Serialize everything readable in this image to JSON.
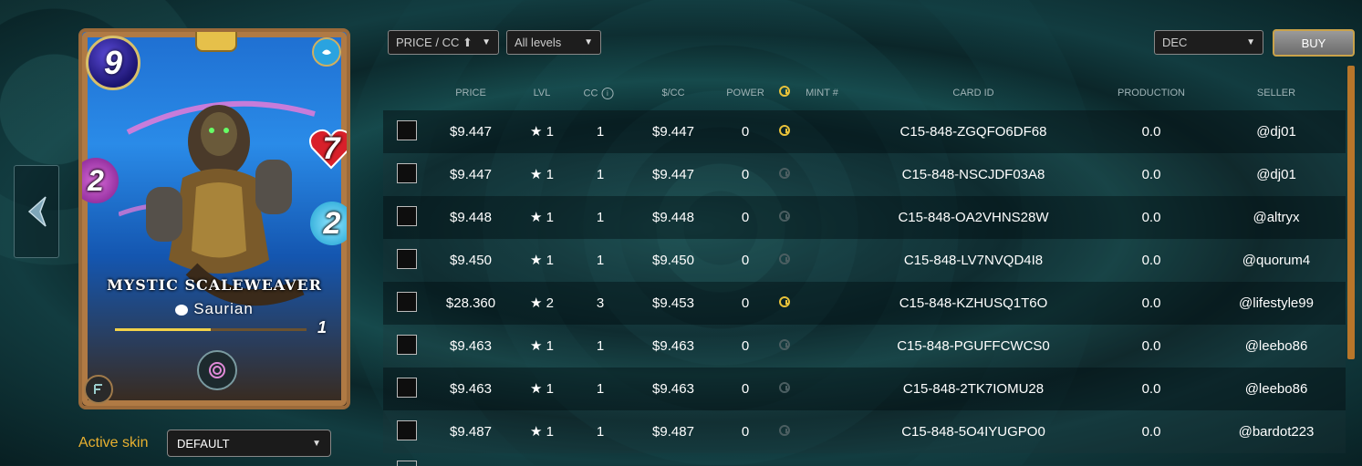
{
  "card": {
    "name": "MYSTIC SCALEWEAVER",
    "type": "Saurian",
    "mana": "9",
    "health": "7",
    "speed": "2",
    "magic": "2",
    "level": "1",
    "xp_fraction": 0.5
  },
  "skin": {
    "label": "Active skin",
    "value": "DEFAULT"
  },
  "filters": {
    "sort": "PRICE / CC ⬆",
    "levels": "All levels",
    "currency": "DEC"
  },
  "buy_label": "BUY",
  "columns": {
    "price": "PRICE",
    "lvl": "LVL",
    "cc": "CC",
    "per_cc": "$/CC",
    "power": "POWER",
    "mint": "MINT #",
    "card_id": "CARD ID",
    "production": "PRODUCTION",
    "seller": "SELLER"
  },
  "rows": [
    {
      "price": "$9.447",
      "lvl": "★ 1",
      "cc": "1",
      "per_cc": "$9.447",
      "power": "0",
      "clock": "on",
      "card_id": "C15-848-ZGQFO6DF68",
      "production": "0.0",
      "seller": "@dj01"
    },
    {
      "price": "$9.447",
      "lvl": "★ 1",
      "cc": "1",
      "per_cc": "$9.447",
      "power": "0",
      "clock": "off",
      "card_id": "C15-848-NSCJDF03A8",
      "production": "0.0",
      "seller": "@dj01"
    },
    {
      "price": "$9.448",
      "lvl": "★ 1",
      "cc": "1",
      "per_cc": "$9.448",
      "power": "0",
      "clock": "off",
      "card_id": "C15-848-OA2VHNS28W",
      "production": "0.0",
      "seller": "@altryx"
    },
    {
      "price": "$9.450",
      "lvl": "★ 1",
      "cc": "1",
      "per_cc": "$9.450",
      "power": "0",
      "clock": "off",
      "card_id": "C15-848-LV7NVQD4I8",
      "production": "0.0",
      "seller": "@quorum4"
    },
    {
      "price": "$28.360",
      "lvl": "★ 2",
      "cc": "3",
      "per_cc": "$9.453",
      "power": "0",
      "clock": "on",
      "card_id": "C15-848-KZHUSQ1T6O",
      "production": "0.0",
      "seller": "@lifestyle99"
    },
    {
      "price": "$9.463",
      "lvl": "★ 1",
      "cc": "1",
      "per_cc": "$9.463",
      "power": "0",
      "clock": "off",
      "card_id": "C15-848-PGUFFCWCS0",
      "production": "0.0",
      "seller": "@leebo86"
    },
    {
      "price": "$9.463",
      "lvl": "★ 1",
      "cc": "1",
      "per_cc": "$9.463",
      "power": "0",
      "clock": "off",
      "card_id": "C15-848-2TK7IOMU28",
      "production": "0.0",
      "seller": "@leebo86"
    },
    {
      "price": "$9.487",
      "lvl": "★ 1",
      "cc": "1",
      "per_cc": "$9.487",
      "power": "0",
      "clock": "off",
      "card_id": "C15-848-5O4IYUGPO0",
      "production": "0.0",
      "seller": "@bardot223"
    }
  ]
}
